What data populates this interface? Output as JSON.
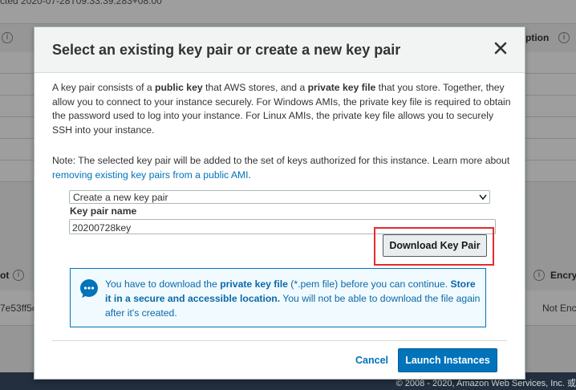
{
  "background": {
    "top_text": "cted 2020-07-28T09:33:39.283+08:00",
    "right_header": "ption",
    "left_header_fragment": "ot",
    "left_id_fragment": "7e53ff5c",
    "right_encryption_header": "Encry",
    "right_encryption_value": "Not Enc"
  },
  "footer": {
    "copyright": "© 2008 - 2020, Amazon Web Services, Inc. 或"
  },
  "modal": {
    "title": "Select an existing key pair or create a new key pair",
    "intro": {
      "p1": "A key pair consists of a ",
      "b1": "public key",
      "p2": " that AWS stores, and a ",
      "b2": "private key file",
      "p3": " that you store. Together, they allow you to connect to your instance securely. For Windows AMIs, the private key file is required to obtain the password used to log into your instance. For Linux AMIs, the private key file allows you to securely SSH into your instance."
    },
    "note": {
      "text": "Note: The selected key pair will be added to the set of keys authorized for this instance. Learn more about ",
      "link": "removing existing key pairs from a public AMI",
      "end": "."
    },
    "key_pair_select": "Create a new key pair",
    "key_pair_name_label": "Key pair name",
    "key_pair_name_value": "20200728key",
    "download_button": "Download Key Pair",
    "info": {
      "p1": "You have to download the ",
      "b1": "private key file",
      "p2": " (*.pem file) before you can continue. ",
      "b2": "Store it in a secure and accessible location.",
      "p3": " You will not be able to download the file again after it's created."
    },
    "cancel_label": "Cancel",
    "launch_label": "Launch Instances"
  },
  "colors": {
    "accent": "#0073bb",
    "highlight": "#e22d2d",
    "info_bg": "#f1faff"
  }
}
